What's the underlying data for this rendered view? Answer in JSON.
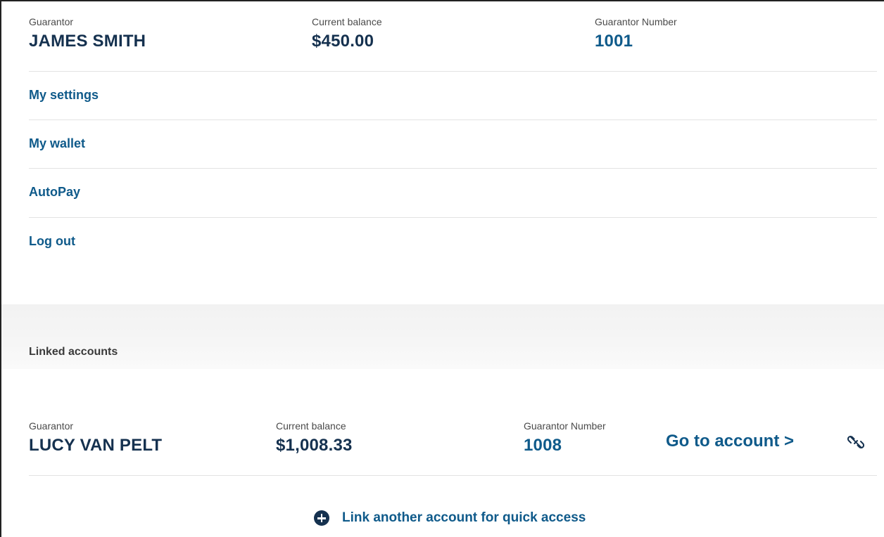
{
  "primary": {
    "guarantor_label": "Guarantor",
    "guarantor_name": "JAMES SMITH",
    "balance_label": "Current balance",
    "balance": "$450.00",
    "number_label": "Guarantor Number",
    "number": "1001"
  },
  "menu": {
    "items": [
      {
        "label": "My settings"
      },
      {
        "label": "My wallet"
      },
      {
        "label": "AutoPay"
      },
      {
        "label": "Log out"
      }
    ]
  },
  "linked": {
    "title": "Linked accounts",
    "accounts": [
      {
        "guarantor_label": "Guarantor",
        "guarantor_name": "LUCY VAN PELT",
        "balance_label": "Current balance",
        "balance": "$1,008.33",
        "number_label": "Guarantor Number",
        "number": "1008",
        "go_label": "Go to account >",
        "unlink_icon": "unlink-icon"
      }
    ],
    "link_another_label": "Link another account for quick access",
    "link_another_icon": "plus-circle-icon"
  },
  "colors": {
    "link_blue": "#0f5a8a",
    "navy": "#15314f",
    "band_gray": "#f4f4f4"
  }
}
